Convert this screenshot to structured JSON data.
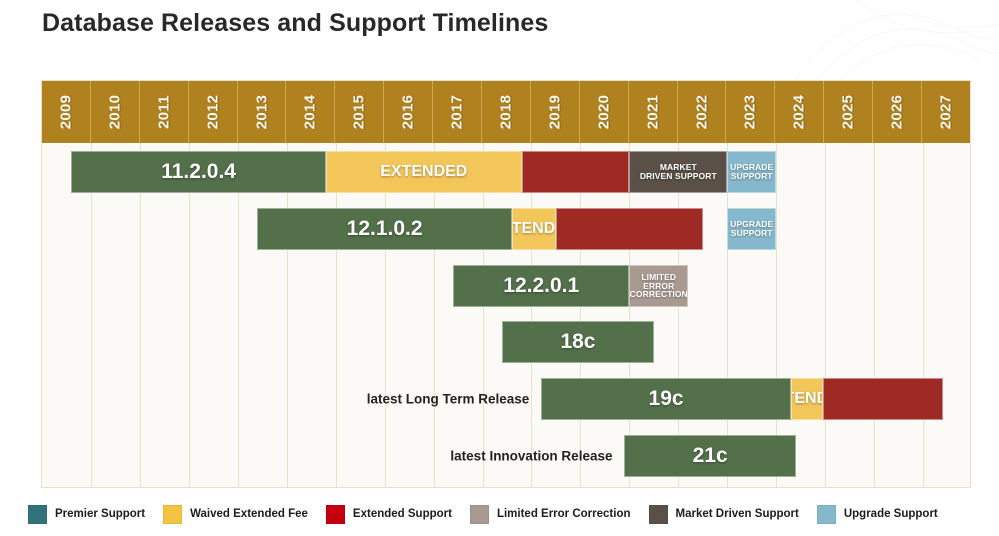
{
  "title": "Database Releases and Support Timelines",
  "chart_data": {
    "type": "timeline",
    "title": "Database Releases and Support Timelines",
    "xlabel": "",
    "ylabel": "",
    "grid": true,
    "legend_position": "bottom",
    "axis_start_year": 2009,
    "axis_end_year": 2027,
    "categories": [
      "2009",
      "2010",
      "2011",
      "2012",
      "2013",
      "2014",
      "2015",
      "2016",
      "2017",
      "2018",
      "2019",
      "2020",
      "2021",
      "2022",
      "2023",
      "2024",
      "2025",
      "2026",
      "2027"
    ],
    "colors": {
      "premier_support": "#53704a",
      "waived_extended_fee": "#f3c659",
      "extended_support": "#9e2a23",
      "limited_error_correction": "#a99a91",
      "market_driven_support": "#5a5048",
      "upgrade_support": "#86b8cd",
      "legend_premier": "#31737a",
      "legend_extended": "#c4000f",
      "header_gold": "#b0811f",
      "plot_background": "#fbfaf6",
      "gridline": "#e8e2cd"
    },
    "series": [
      {
        "name": "11.2.0.4",
        "row_label": "",
        "segments": [
          {
            "label": "11.2.0.4",
            "type": "premier_support",
            "color": "#53704a",
            "start_year": 2009.6,
            "end_year": 2014.8,
            "label_size": "big"
          },
          {
            "label": "EXTENDED",
            "type": "waived_extended_fee",
            "color": "#f3c659",
            "start_year": 2014.8,
            "end_year": 2018.8,
            "label_size": "small"
          },
          {
            "label": "",
            "type": "extended_support",
            "color": "#9e2a23",
            "start_year": 2018.8,
            "end_year": 2021.0,
            "label_size": "small"
          },
          {
            "label": "MARKET\nDRIVEN SUPPORT",
            "type": "market_driven_support",
            "color": "#5a5048",
            "start_year": 2021.0,
            "end_year": 2023.0,
            "label_size": "tiny"
          },
          {
            "label": "UPGRADE\nSUPPORT",
            "type": "upgrade_support",
            "color": "#86b8cd",
            "start_year": 2023.0,
            "end_year": 2024.0,
            "label_size": "tiny"
          }
        ]
      },
      {
        "name": "12.1.0.2",
        "row_label": "",
        "segments": [
          {
            "label": "12.1.0.2",
            "type": "premier_support",
            "color": "#53704a",
            "start_year": 2013.4,
            "end_year": 2018.6,
            "label_size": "big"
          },
          {
            "label": "EXTENDED",
            "type": "waived_extended_fee",
            "color": "#f3c659",
            "start_year": 2018.6,
            "end_year": 2019.5,
            "label_size": "small"
          },
          {
            "label": "",
            "type": "extended_support",
            "color": "#9e2a23",
            "start_year": 2019.5,
            "end_year": 2022.5,
            "label_size": "small"
          },
          {
            "label": "UPGRADE\nSUPPORT",
            "type": "upgrade_support",
            "color": "#86b8cd",
            "start_year": 2023.0,
            "end_year": 2024.0,
            "label_size": "tiny"
          }
        ]
      },
      {
        "name": "12.2.0.1",
        "row_label": "",
        "segments": [
          {
            "label": "12.2.0.1",
            "type": "premier_support",
            "color": "#53704a",
            "start_year": 2017.4,
            "end_year": 2021.0,
            "label_size": "big"
          },
          {
            "label": "LIMITED ERROR\nCORRECTION",
            "type": "limited_error_correction",
            "color": "#a99a91",
            "start_year": 2021.0,
            "end_year": 2022.2,
            "label_size": "tiny"
          }
        ]
      },
      {
        "name": "18c",
        "row_label": "",
        "segments": [
          {
            "label": "18c",
            "type": "premier_support",
            "color": "#53704a",
            "start_year": 2018.4,
            "end_year": 2021.5,
            "label_size": "big"
          }
        ]
      },
      {
        "name": "19c",
        "row_label": "latest Long Term Release",
        "segments": [
          {
            "label": "19c",
            "type": "premier_support",
            "color": "#53704a",
            "start_year": 2019.2,
            "end_year": 2024.3,
            "label_size": "big"
          },
          {
            "label": "EXTENDED",
            "type": "waived_extended_fee",
            "color": "#f3c659",
            "start_year": 2024.3,
            "end_year": 2024.95,
            "label_size": "small"
          },
          {
            "label": "",
            "type": "extended_support",
            "color": "#9e2a23",
            "start_year": 2024.95,
            "end_year": 2027.4,
            "label_size": "small"
          }
        ]
      },
      {
        "name": "21c",
        "row_label": "latest Innovation Release",
        "segments": [
          {
            "label": "21c",
            "type": "premier_support",
            "color": "#53704a",
            "start_year": 2020.9,
            "end_year": 2024.4,
            "label_size": "big"
          }
        ]
      }
    ],
    "legend": [
      {
        "label": "Premier Support",
        "color": "#31737a"
      },
      {
        "label": "Waived Extended Fee",
        "color": "#f5c342"
      },
      {
        "label": "Extended Support",
        "color": "#c4000f"
      },
      {
        "label": "Limited Error Correction",
        "color": "#a99a91"
      },
      {
        "label": "Market Driven Support",
        "color": "#5a5048"
      },
      {
        "label": "Upgrade Support",
        "color": "#86b8cd"
      }
    ]
  }
}
